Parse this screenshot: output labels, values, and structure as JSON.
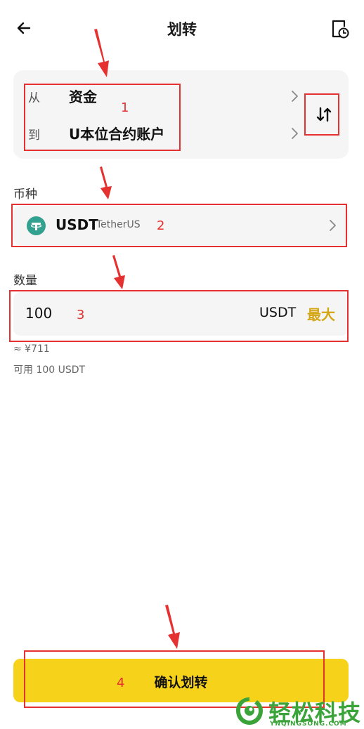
{
  "header": {
    "title": "划转",
    "back_icon": "back-arrow-icon",
    "history_icon": "history-icon"
  },
  "account": {
    "from_label": "从",
    "from_value": "资金",
    "to_label": "到",
    "to_value": "U本位合约账户",
    "swap_icon": "swap-vertical-icon"
  },
  "coin": {
    "section_label": "币种",
    "symbol": "USDT",
    "name": "TetherUS",
    "icon": "tether-icon"
  },
  "amount": {
    "section_label": "数量",
    "value": "100",
    "unit": "USDT",
    "max_label": "最大",
    "approx": "≈ ¥711",
    "available": "可用 100 USDT"
  },
  "confirm": {
    "label": "确认划转"
  },
  "annotations": {
    "n1": "1",
    "n2": "2",
    "n3": "3",
    "n4": "4"
  },
  "watermark": {
    "text": "轻松科技",
    "sub": "YNQINGSONG.COM"
  },
  "colors": {
    "accent": "#f7d21a",
    "max": "#d4a514",
    "annotation": "#e5312f",
    "tether": "#33a18f"
  }
}
